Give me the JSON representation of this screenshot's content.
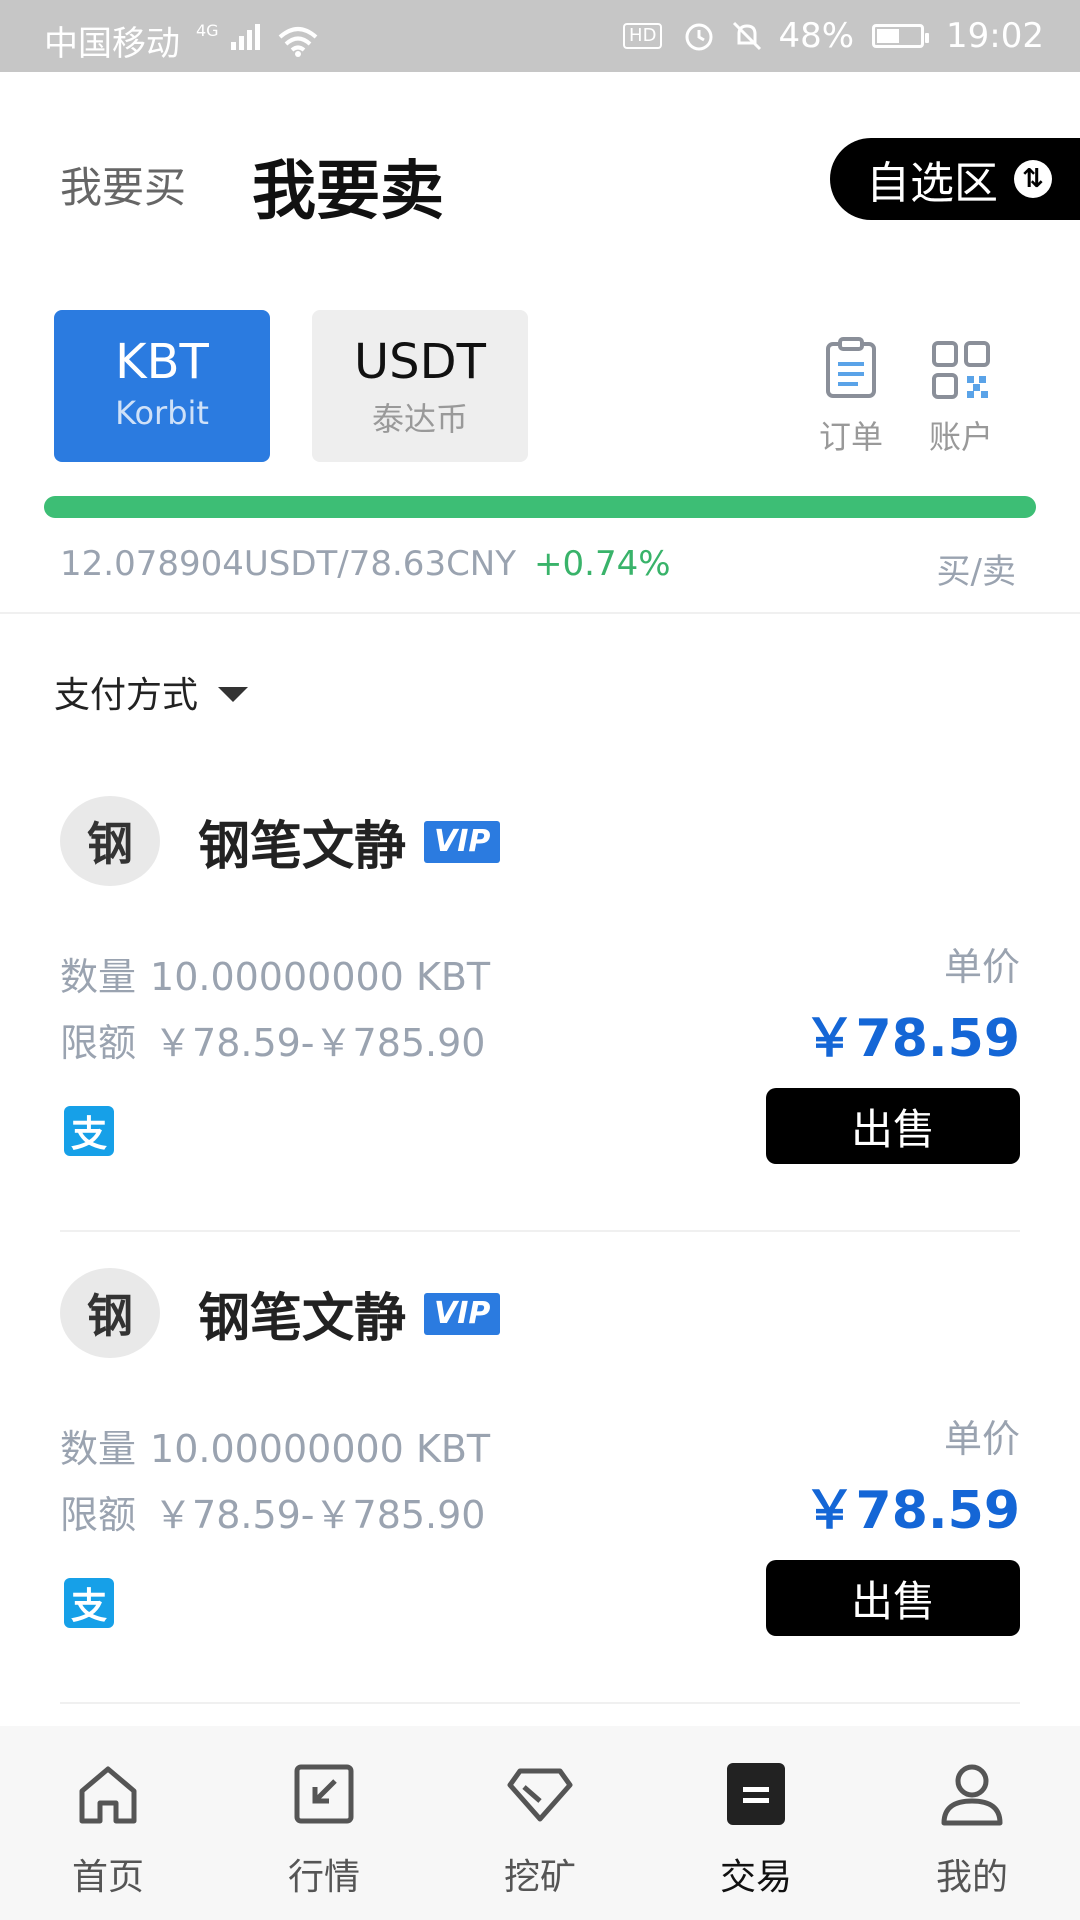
{
  "status_bar": {
    "carrier": "中国移动",
    "network": "4G",
    "hd": "HD",
    "battery": "48%",
    "time": "19:02"
  },
  "header": {
    "buy_tab": "我要买",
    "sell_tab": "我要卖",
    "favorites_label": "自选区"
  },
  "coins": [
    {
      "symbol": "KBT",
      "name": "Korbit"
    },
    {
      "symbol": "USDT",
      "name": "泰达币"
    }
  ],
  "quick_links": {
    "orders": "订单",
    "account": "账户"
  },
  "market": {
    "rate": "12.078904USDT/78.63CNY",
    "change": "+0.74%",
    "buysell_label": "买/卖"
  },
  "filter": {
    "payment_label": "支付方式"
  },
  "listings": [
    {
      "avatar_char": "钢",
      "seller": "钢笔文静",
      "badge": "VIP",
      "qty_label": "数量",
      "qty": "10.00000000 KBT",
      "limit_label": "限额",
      "limit": "￥78.59-￥785.90",
      "price_label": "单价",
      "price": "￥78.59",
      "payment_icon": "支",
      "action": "出售"
    },
    {
      "avatar_char": "钢",
      "seller": "钢笔文静",
      "badge": "VIP",
      "qty_label": "数量",
      "qty": "10.00000000 KBT",
      "limit_label": "限额",
      "limit": "￥78.59-￥785.90",
      "price_label": "单价",
      "price": "￥78.59",
      "payment_icon": "支",
      "action": "出售"
    }
  ],
  "nav": [
    {
      "label": "首页",
      "icon": "home-icon"
    },
    {
      "label": "行情",
      "icon": "market-icon"
    },
    {
      "label": "挖矿",
      "icon": "mining-icon"
    },
    {
      "label": "交易",
      "icon": "trade-icon"
    },
    {
      "label": "我的",
      "icon": "profile-icon"
    }
  ],
  "colors": {
    "accent_blue": "#2b7be0",
    "price_blue": "#1466d6",
    "positive_green": "#39b36a",
    "progress_green": "#3dbe75"
  }
}
